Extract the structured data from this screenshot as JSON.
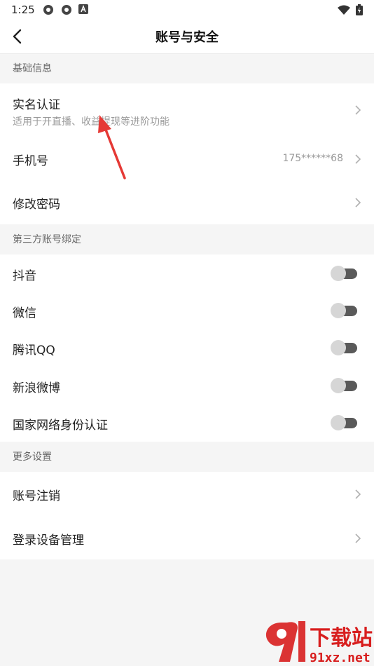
{
  "status_bar": {
    "time": "1:25"
  },
  "header": {
    "title": "账号与安全"
  },
  "sections": [
    {
      "title": "基础信息",
      "rows": [
        {
          "title": "实名认证",
          "subtitle": "适用于开直播、收益提现等进阶功能"
        },
        {
          "title": "手机号",
          "value": "175******68"
        },
        {
          "title": "修改密码"
        }
      ]
    },
    {
      "title": "第三方账号绑定",
      "rows": [
        {
          "title": "抖音",
          "enabled": false
        },
        {
          "title": "微信",
          "enabled": false
        },
        {
          "title": "腾讯QQ",
          "enabled": false
        },
        {
          "title": "新浪微博",
          "enabled": false
        },
        {
          "title": "国家网络身份认证",
          "enabled": false
        }
      ]
    },
    {
      "title": "更多设置",
      "rows": [
        {
          "title": "账号注销"
        },
        {
          "title": "登录设备管理"
        }
      ]
    }
  ],
  "watermark": {
    "text_main": "下载站",
    "text_url": "91xz.net"
  },
  "colors": {
    "annotation_arrow": "#e53935",
    "watermark_red": "#d81e1e"
  }
}
